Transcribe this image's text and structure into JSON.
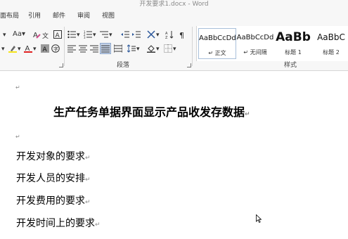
{
  "window": {
    "title": "开发要求1.docx - Word"
  },
  "tabs": [
    "面布局",
    "引用",
    "邮件",
    "审阅",
    "视图"
  ],
  "ribbon": {
    "font": {
      "grow_font": "A",
      "shrink_font": "Aa",
      "clear_format": "A",
      "font_color": "A",
      "char_shading": "A",
      "enclosed_char": "字"
    },
    "groups": {
      "paragraph": "段落",
      "styles": "样式"
    },
    "styles": [
      {
        "sample": "AaBbCcDd",
        "name": "↵ 正文",
        "selected": true
      },
      {
        "sample": "AaBbCcDd",
        "name": "↵ 无间隔",
        "selected": false
      },
      {
        "sample": "AaBb",
        "name": "标题 1",
        "selected": false
      },
      {
        "sample": "AaBbC",
        "name": "标题 2",
        "selected": false
      }
    ]
  },
  "document": {
    "paragraph_mark": "↵",
    "title": "生产任务单据界面显示产品收发存数据",
    "lines": [
      "开发对象的要求",
      "开发人员的安排",
      "开发费用的要求",
      "开发时间上的要求"
    ]
  },
  "colors": {
    "font_color_bar": "#e02020",
    "highlight_bar": "#f5e41a",
    "accent_blue": "#2b579a"
  }
}
